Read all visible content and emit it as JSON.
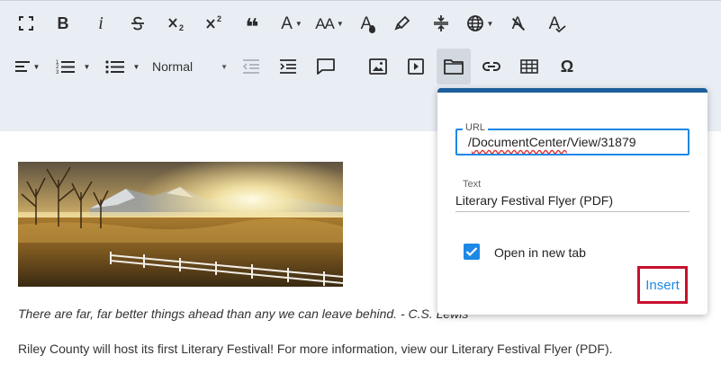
{
  "toolbar": {
    "row1": [
      {
        "name": "fullscreen-icon"
      },
      {
        "name": "bold-icon",
        "glyph": "B"
      },
      {
        "name": "italic-icon",
        "glyph": "i"
      },
      {
        "name": "strikethrough-icon"
      },
      {
        "name": "subscript-icon"
      },
      {
        "name": "superscript-icon"
      },
      {
        "name": "quote-icon",
        "glyph": "❝"
      },
      {
        "name": "font-family-icon",
        "glyph": "A"
      },
      {
        "name": "font-size-icon",
        "glyph": "AA"
      },
      {
        "name": "text-color-icon",
        "glyph": "A"
      },
      {
        "name": "highlight-icon"
      },
      {
        "name": "line-height-icon"
      },
      {
        "name": "language-globe-icon"
      },
      {
        "name": "clear-formatting-icon",
        "glyph": "A"
      },
      {
        "name": "spellcheck-icon",
        "glyph": "A"
      }
    ],
    "paragraph_style": "Normal",
    "active_item": "insert-link-folder"
  },
  "link_dialog": {
    "url_label": "URL",
    "url_prefix": "/",
    "url_squiggle": "DocumentCenter",
    "url_rest": "/View/31879",
    "text_label": "Text",
    "text_value": "Literary Festival Flyer (PDF)",
    "new_tab_label": "Open in new tab",
    "new_tab_checked": true,
    "insert_label": "Insert"
  },
  "content": {
    "quote": "There are far, far better things ahead than any we can leave behind. - C.S. Lewis",
    "paragraph": "Riley County will host its first Literary Festival! For more information, view our Literary Festival Flyer (PDF)."
  },
  "colors": {
    "toolbar_bg": "#e9eef4",
    "accent": "#1e88e5",
    "dialog_top": "#1d5f9b",
    "highlight_box": "#c8102e"
  }
}
